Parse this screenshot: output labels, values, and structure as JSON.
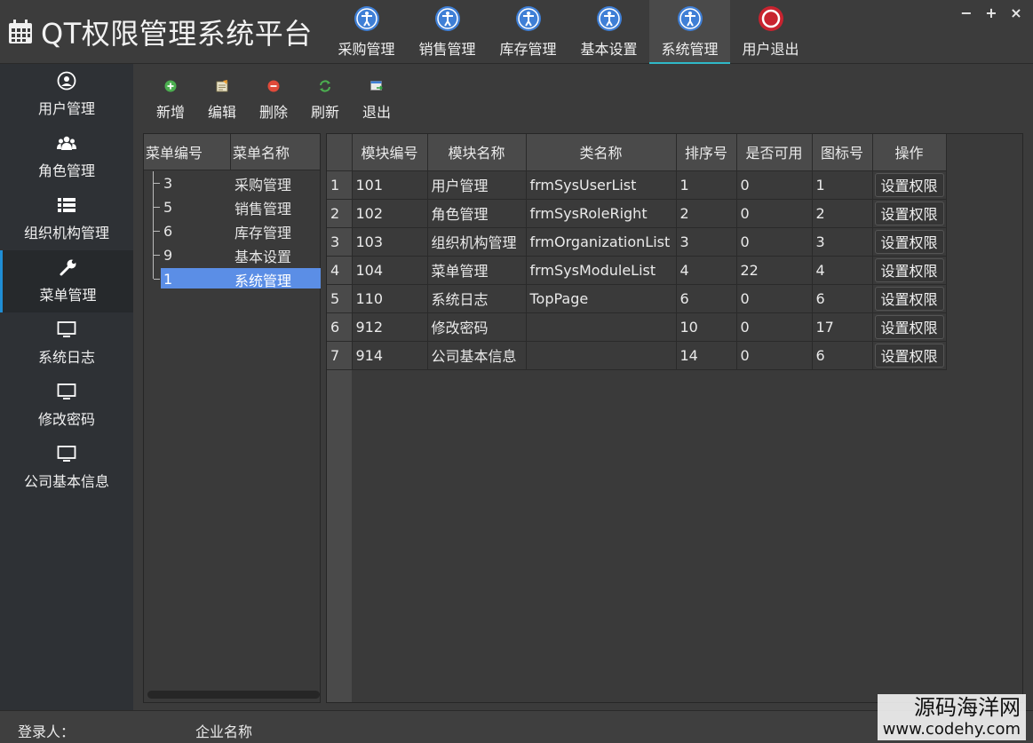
{
  "app": {
    "title": "QT权限管理系统平台"
  },
  "topnav": [
    {
      "label": "采购管理",
      "icon": "accessibility-icon",
      "active": false
    },
    {
      "label": "销售管理",
      "icon": "accessibility-icon",
      "active": false
    },
    {
      "label": "库存管理",
      "icon": "accessibility-icon",
      "active": false
    },
    {
      "label": "基本设置",
      "icon": "accessibility-icon",
      "active": false
    },
    {
      "label": "系统管理",
      "icon": "accessibility-icon",
      "active": true
    },
    {
      "label": "用户退出",
      "icon": "power-icon",
      "active": false
    }
  ],
  "window_controls": {
    "minimize": "−",
    "maximize": "+",
    "close": "×"
  },
  "sidebar": [
    {
      "label": "用户管理",
      "icon": "user-circle-icon"
    },
    {
      "label": "角色管理",
      "icon": "users-icon"
    },
    {
      "label": "组织机构管理",
      "icon": "list-icon"
    },
    {
      "label": "菜单管理",
      "icon": "wrench-icon",
      "active": true
    },
    {
      "label": "系统日志",
      "icon": "monitor-icon"
    },
    {
      "label": "修改密码",
      "icon": "monitor-icon"
    },
    {
      "label": "公司基本信息",
      "icon": "monitor-icon"
    }
  ],
  "toolbar": [
    {
      "label": "新增",
      "icon": "add-icon"
    },
    {
      "label": "编辑",
      "icon": "edit-icon"
    },
    {
      "label": "删除",
      "icon": "delete-icon"
    },
    {
      "label": "刷新",
      "icon": "refresh-icon"
    },
    {
      "label": "退出",
      "icon": "exit-icon"
    }
  ],
  "tree": {
    "headers": [
      "菜单编号",
      "菜单名称"
    ],
    "rows": [
      {
        "id": "3",
        "name": "采购管理",
        "selected": false
      },
      {
        "id": "5",
        "name": "销售管理",
        "selected": false
      },
      {
        "id": "6",
        "name": "库存管理",
        "selected": false
      },
      {
        "id": "9",
        "name": "基本设置",
        "selected": false
      },
      {
        "id": "1",
        "name": "系统管理",
        "selected": true
      }
    ]
  },
  "grid": {
    "headers": [
      "模块编号",
      "模块名称",
      "类名称",
      "排序号",
      "是否可用",
      "图标号",
      "操作"
    ],
    "rows": [
      {
        "no": "1",
        "code": "101",
        "name": "用户管理",
        "class": "frmSysUserList",
        "sort": "1",
        "enabled": "0",
        "icon": "1",
        "action": "设置权限"
      },
      {
        "no": "2",
        "code": "102",
        "name": "角色管理",
        "class": "frmSysRoleRight",
        "sort": "2",
        "enabled": "0",
        "icon": "2",
        "action": "设置权限"
      },
      {
        "no": "3",
        "code": "103",
        "name": "组织机构管理",
        "class": "frmOrganizationList",
        "sort": "3",
        "enabled": "0",
        "icon": "3",
        "action": "设置权限"
      },
      {
        "no": "4",
        "code": "104",
        "name": "菜单管理",
        "class": "frmSysModuleList",
        "sort": "4",
        "enabled": "22",
        "icon": "4",
        "action": "设置权限"
      },
      {
        "no": "5",
        "code": "110",
        "name": "系统日志",
        "class": "TopPage",
        "sort": "6",
        "enabled": "0",
        "icon": "6",
        "action": "设置权限"
      },
      {
        "no": "6",
        "code": "912",
        "name": "修改密码",
        "class": "",
        "sort": "10",
        "enabled": "0",
        "icon": "17",
        "action": "设置权限"
      },
      {
        "no": "7",
        "code": "914",
        "name": "公司基本信息",
        "class": "",
        "sort": "14",
        "enabled": "0",
        "icon": "6",
        "action": "设置权限"
      }
    ]
  },
  "statusbar": {
    "login_label": "登录人：",
    "company_label": "企业名称"
  },
  "watermark": {
    "line1": "源码海洋网",
    "line2": "www.codehy.com"
  },
  "colors": {
    "accent_tab": "#2fb9c8",
    "sidebar_active": "#1f8ed6",
    "selection": "#5b8ee6"
  }
}
